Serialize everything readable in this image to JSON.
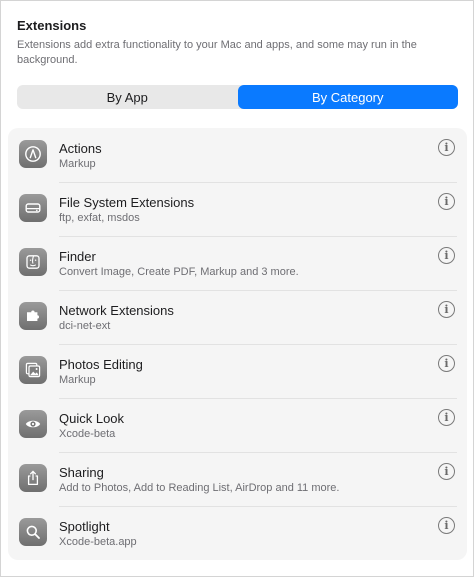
{
  "header": {
    "title": "Extensions",
    "description": "Extensions add extra functionality to your Mac and apps, and some may run in the background."
  },
  "segmented": {
    "options": [
      {
        "label": "By App",
        "selected": false
      },
      {
        "label": "By Category",
        "selected": true
      }
    ],
    "accent_color": "#0a7aff"
  },
  "categories": [
    {
      "title": "Actions",
      "subtitle": "Markup",
      "icon": "actions-icon"
    },
    {
      "title": "File System Extensions",
      "subtitle": "ftp, exfat, msdos",
      "icon": "drive-icon"
    },
    {
      "title": "Finder",
      "subtitle": "Convert Image, Create PDF, Markup and 3 more.",
      "icon": "finder-icon"
    },
    {
      "title": "Network Extensions",
      "subtitle": "dci-net-ext",
      "icon": "puzzle-icon"
    },
    {
      "title": "Photos Editing",
      "subtitle": "Markup",
      "icon": "photos-icon"
    },
    {
      "title": "Quick Look",
      "subtitle": "Xcode-beta",
      "icon": "eye-icon"
    },
    {
      "title": "Sharing",
      "subtitle": "Add to Photos, Add to Reading List, AirDrop and 11 more.",
      "icon": "share-icon"
    },
    {
      "title": "Spotlight",
      "subtitle": "Xcode-beta.app",
      "icon": "magnifier-icon"
    }
  ],
  "info_glyph": "i"
}
